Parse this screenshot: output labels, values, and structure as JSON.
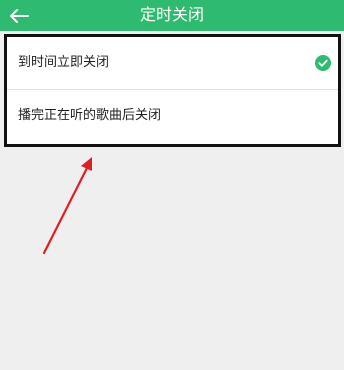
{
  "header": {
    "title": "定时关闭",
    "back_icon": "back-arrow-icon"
  },
  "options": [
    {
      "label": "到时间立即关闭",
      "selected": true
    },
    {
      "label": "播完正在听的歌曲后关闭",
      "selected": false
    }
  ],
  "colors": {
    "accent": "#2fbb6f",
    "annotation_arrow": "#e02020",
    "highlight_border": "#111111"
  },
  "icons": {
    "selected": "check-circle-icon"
  }
}
